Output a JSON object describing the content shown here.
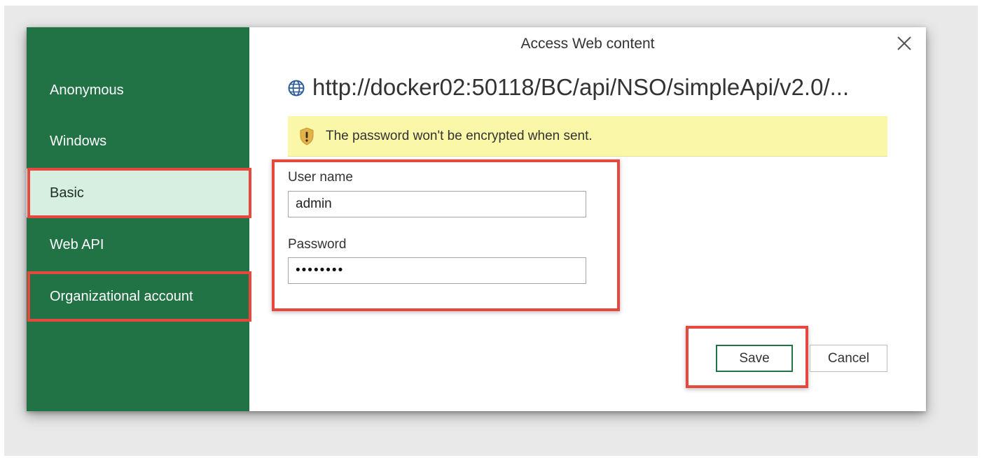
{
  "dialog": {
    "title": "Access Web content",
    "url": "http://docker02:50118/BC/api/NSO/simpleApi/v2.0/...",
    "warning": "The password won't be encrypted when sent."
  },
  "sidebar": {
    "items": [
      {
        "label": "Anonymous",
        "selected": false
      },
      {
        "label": "Windows",
        "selected": false
      },
      {
        "label": "Basic",
        "selected": true
      },
      {
        "label": "Web API",
        "selected": false
      },
      {
        "label": "Organizational account",
        "selected": false
      }
    ]
  },
  "form": {
    "username_label": "User name",
    "username_value": "admin",
    "password_label": "Password",
    "password_mask": "••••••••"
  },
  "buttons": {
    "save_label": "Save",
    "cancel_label": "Cancel"
  },
  "colors": {
    "sidebar_green": "#217346",
    "selected_bg": "#d6efe0",
    "warning_bg": "#fbf7a8",
    "highlight_red": "#e8473e"
  },
  "icons": {
    "url": "globe-icon",
    "warning": "shield-warning-icon",
    "close": "close-icon"
  }
}
